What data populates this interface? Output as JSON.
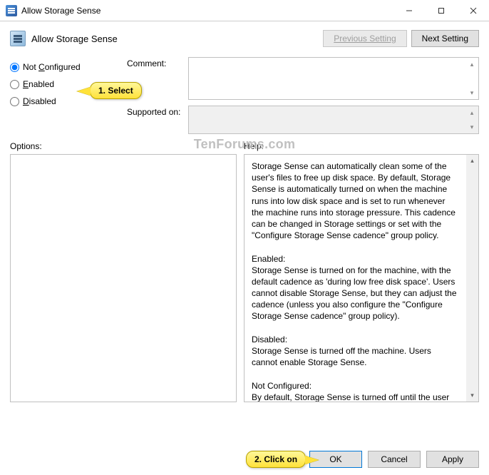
{
  "window": {
    "title": "Allow Storage Sense"
  },
  "toolbar": {
    "title": "Allow Storage Sense",
    "prev_label": "Previous Setting",
    "next_label": "Next Setting"
  },
  "radios": {
    "not_configured": "Not Configured",
    "enabled": "Enabled",
    "disabled": "Disabled",
    "selected": "not_configured"
  },
  "fields": {
    "comment_label": "Comment:",
    "comment_value": "",
    "supported_label": "Supported on:",
    "supported_value": ""
  },
  "columns": {
    "options_label": "Options:",
    "help_label": "Help:"
  },
  "help": {
    "p1": "Storage Sense can automatically clean some of the user's files to free up disk space. By default, Storage Sense is automatically turned on when the machine runs into low disk space and is set to run whenever the machine runs into storage pressure. This cadence can be changed in Storage settings or set with the \"Configure Storage Sense cadence\" group policy.",
    "h2": "Enabled:",
    "p2": "Storage Sense is turned on for the machine, with the default cadence as 'during low free disk space'. Users cannot disable Storage Sense, but they can adjust the cadence (unless you also configure the \"Configure Storage Sense cadence\" group policy).",
    "h3": "Disabled:",
    "p3": "Storage Sense is turned off the machine. Users cannot enable Storage Sense.",
    "h4": "Not Configured:",
    "p4": "By default, Storage Sense is turned off until the user runs into low disk space or the user enables it manually. Users can configure this setting in Storage settings."
  },
  "footer": {
    "ok": "OK",
    "cancel": "Cancel",
    "apply": "Apply"
  },
  "callouts": {
    "c1": "1. Select",
    "c2": "2. Click on"
  },
  "watermark": "TenForums.com"
}
